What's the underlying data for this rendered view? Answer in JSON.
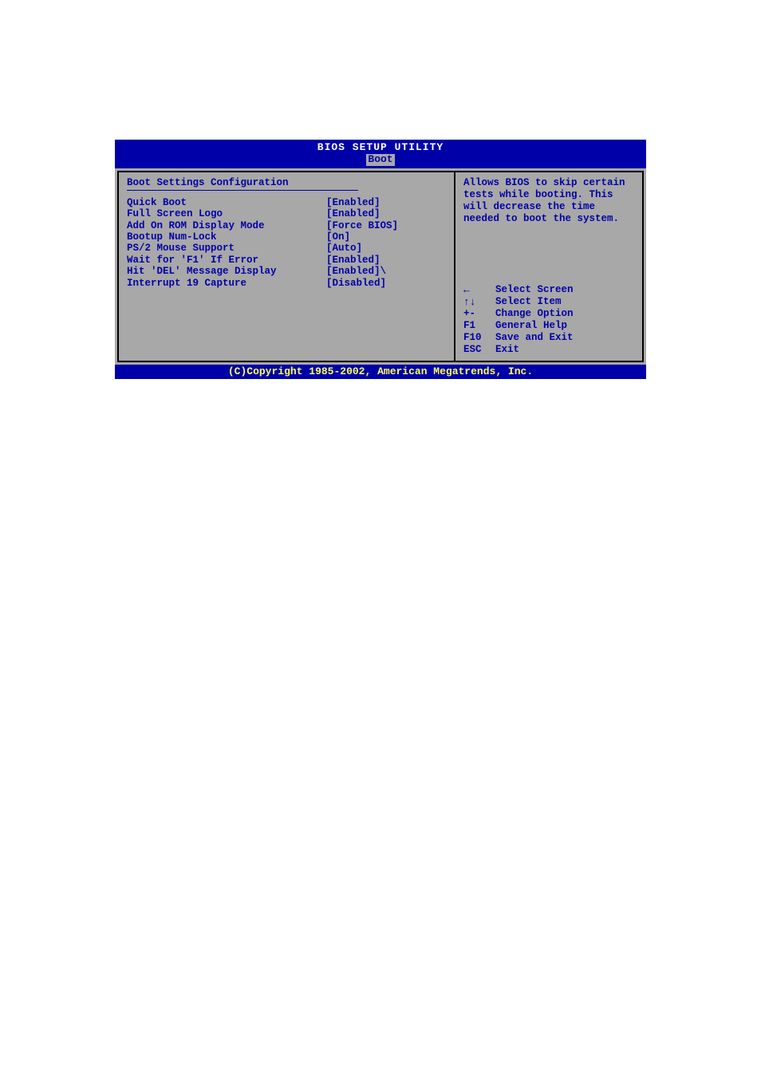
{
  "header": {
    "title": "BIOS SETUP UTILITY",
    "active_tab": "Boot"
  },
  "left": {
    "section_title": "Boot Settings Configuration",
    "settings": [
      {
        "label": "Quick Boot",
        "value": "[Enabled]"
      },
      {
        "label": "Full Screen Logo",
        "value": "[Enabled]"
      },
      {
        "label": "Add On ROM Display Mode",
        "value": "[Force BIOS]"
      },
      {
        "label": "Bootup Num-Lock",
        "value": "[On]"
      },
      {
        "label": "PS/2 Mouse Support",
        "value": "[Auto]"
      },
      {
        "label": "Wait for 'F1' If Error",
        "value": "[Enabled]"
      },
      {
        "label": "Hit 'DEL' Message Display",
        "value": "[Enabled]\\"
      },
      {
        "label": "Interrupt 19 Capture",
        "value": "[Disabled]"
      }
    ]
  },
  "right": {
    "help_text": "Allows BIOS to skip certain tests while booting. This will decrease the time needed to boot the system.",
    "nav": [
      {
        "key_glyph": "←",
        "key_text": "",
        "label": "Select Screen"
      },
      {
        "key_glyph": "↑↓",
        "key_text": "",
        "label": "Select Item"
      },
      {
        "key_glyph": "",
        "key_text": "+-",
        "label": "Change Option"
      },
      {
        "key_glyph": "",
        "key_text": "F1",
        "label": "General Help"
      },
      {
        "key_glyph": "",
        "key_text": "F10",
        "label": "Save and Exit"
      },
      {
        "key_glyph": "",
        "key_text": "ESC",
        "label": "Exit"
      }
    ]
  },
  "footer": {
    "copyright": "(C)Copyright 1985-2002, American Megatrends, Inc."
  }
}
